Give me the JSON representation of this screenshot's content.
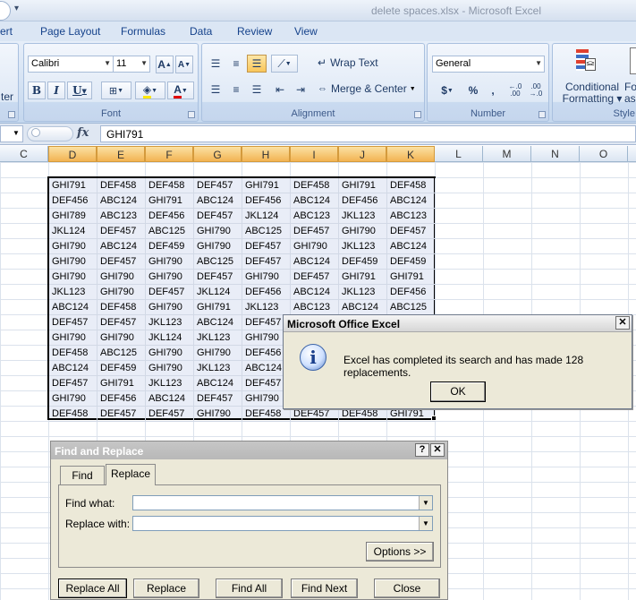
{
  "window": {
    "title": "delete spaces.xlsx - Microsoft Excel",
    "qa_dropdown": "▾"
  },
  "tabs": [
    "ert",
    "Page Layout",
    "Formulas",
    "Data",
    "Review",
    "View"
  ],
  "ribbon": {
    "clipboard_partial": "ter",
    "font": {
      "name": "Calibri",
      "size": "11",
      "grow": "A",
      "shrink": "A",
      "bold": "B",
      "italic": "I",
      "underline": "U",
      "label": "Font"
    },
    "alignment": {
      "wrap": "Wrap Text",
      "merge": "Merge & Center",
      "label": "Alignment"
    },
    "number": {
      "format": "General",
      "currency": "$",
      "percent": "%",
      "comma": ",",
      "inc": ".0→.00",
      "dec": ".00→.0",
      "label": "Number"
    },
    "styles": {
      "cond1": "Conditional",
      "cond2": "Formatting ▾",
      "fmt1": "Fo",
      "fmt2": "as T",
      "label": "Style"
    }
  },
  "formula_bar": {
    "fx": "fx",
    "value": "GHI791"
  },
  "columns": [
    {
      "label": "C",
      "selected": false
    },
    {
      "label": "D",
      "selected": true
    },
    {
      "label": "E",
      "selected": true
    },
    {
      "label": "F",
      "selected": true
    },
    {
      "label": "G",
      "selected": true
    },
    {
      "label": "H",
      "selected": true
    },
    {
      "label": "I",
      "selected": true
    },
    {
      "label": "J",
      "selected": true
    },
    {
      "label": "K",
      "selected": true
    },
    {
      "label": "L",
      "selected": false
    },
    {
      "label": "M",
      "selected": false
    },
    {
      "label": "N",
      "selected": false
    },
    {
      "label": "O",
      "selected": false
    }
  ],
  "cells": [
    [
      "GHI791",
      "DEF458",
      "DEF458",
      "DEF457",
      "GHI791",
      "DEF458",
      "GHI791",
      "DEF458"
    ],
    [
      "DEF456",
      "ABC124",
      "GHI791",
      "ABC124",
      "DEF456",
      "ABC124",
      "DEF456",
      "ABC124"
    ],
    [
      "GHI789",
      "ABC123",
      "DEF456",
      "DEF457",
      "JKL124",
      "ABC123",
      "JKL123",
      "ABC123"
    ],
    [
      "JKL124",
      "DEF457",
      "ABC125",
      "GHI790",
      "ABC125",
      "DEF457",
      "GHI790",
      "DEF457"
    ],
    [
      "GHI790",
      "ABC124",
      "DEF459",
      "GHI790",
      "DEF457",
      "GHI790",
      "JKL123",
      "ABC124"
    ],
    [
      "GHI790",
      "DEF457",
      "GHI790",
      "ABC125",
      "DEF457",
      "ABC124",
      "DEF459",
      "DEF459"
    ],
    [
      "GHI790",
      "GHI790",
      "GHI790",
      "DEF457",
      "GHI790",
      "DEF457",
      "GHI791",
      "GHI791"
    ],
    [
      "JKL123",
      "GHI790",
      "DEF457",
      "JKL124",
      "DEF456",
      "ABC124",
      "JKL123",
      "DEF456"
    ],
    [
      "ABC124",
      "DEF458",
      "GHI790",
      "GHI791",
      "JKL123",
      "ABC123",
      "ABC124",
      "ABC125"
    ],
    [
      "DEF457",
      "DEF457",
      "JKL123",
      "ABC124",
      "DEF457",
      "",
      "",
      ""
    ],
    [
      "GHI790",
      "GHI790",
      "JKL124",
      "JKL123",
      "GHI790",
      "",
      "",
      ""
    ],
    [
      "DEF458",
      "ABC125",
      "GHI790",
      "GHI790",
      "DEF456",
      "",
      "",
      ""
    ],
    [
      "ABC124",
      "DEF459",
      "GHI790",
      "JKL123",
      "ABC124",
      "",
      "",
      ""
    ],
    [
      "DEF457",
      "GHI791",
      "JKL123",
      "ABC124",
      "DEF457",
      "",
      "",
      ""
    ],
    [
      "GHI790",
      "DEF456",
      "ABC124",
      "DEF457",
      "GHI790",
      "",
      "",
      ""
    ],
    [
      "DEF458",
      "DEF457",
      "DEF457",
      "GHI790",
      "DEF458",
      "DEF457",
      "DEF458",
      "GHI791"
    ]
  ],
  "message_box": {
    "title": "Microsoft Office Excel",
    "text": "Excel has completed its search and has made 128 replacements.",
    "ok": "OK",
    "close": "✕"
  },
  "find_replace": {
    "title": "Find and Replace",
    "help": "?",
    "close": "✕",
    "tab_find": "Find",
    "tab_replace": "Replace",
    "find_label": "Find what:",
    "find_value": "",
    "replace_label": "Replace with:",
    "replace_value": "",
    "options": "Options >>",
    "buttons": [
      "Replace All",
      "Replace",
      "Find All",
      "Find Next",
      "Close"
    ]
  }
}
